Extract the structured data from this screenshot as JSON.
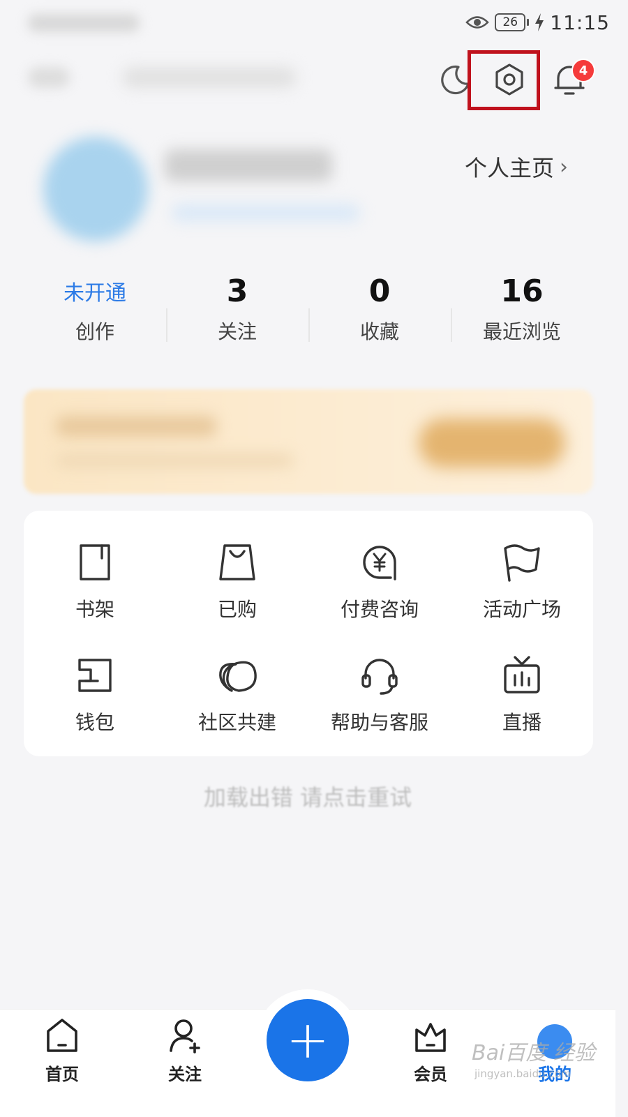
{
  "status_bar": {
    "time": "11:15",
    "battery": "26"
  },
  "header": {
    "notification_count": "4"
  },
  "profile": {
    "link_label": "个人主页",
    "chevron": "›"
  },
  "stats": [
    {
      "value": "未开通",
      "label": "创作"
    },
    {
      "value": "3",
      "label": "关注"
    },
    {
      "value": "0",
      "label": "收藏"
    },
    {
      "value": "16",
      "label": "最近浏览"
    }
  ],
  "grid": [
    {
      "label": "书架",
      "icon": "bookshelf-icon"
    },
    {
      "label": "已购",
      "icon": "shopping-bag-icon"
    },
    {
      "label": "付费咨询",
      "icon": "paid-consult-icon"
    },
    {
      "label": "活动广场",
      "icon": "flag-icon"
    },
    {
      "label": "钱包",
      "icon": "wallet-icon"
    },
    {
      "label": "社区共建",
      "icon": "community-icon"
    },
    {
      "label": "帮助与客服",
      "icon": "headset-icon"
    },
    {
      "label": "直播",
      "icon": "tv-icon"
    }
  ],
  "error": {
    "text": "加载出错 请点击重试"
  },
  "bottom_nav": {
    "home": "首页",
    "follow": "关注",
    "add": "+",
    "vip": "会员",
    "mine": "我的"
  },
  "watermark": {
    "brand": "Bai百度 经验",
    "url": "jingyan.baidu.com"
  },
  "colors": {
    "accent": "#1a74e8",
    "badge": "#f53b3b",
    "highlight": "#c0121d"
  }
}
